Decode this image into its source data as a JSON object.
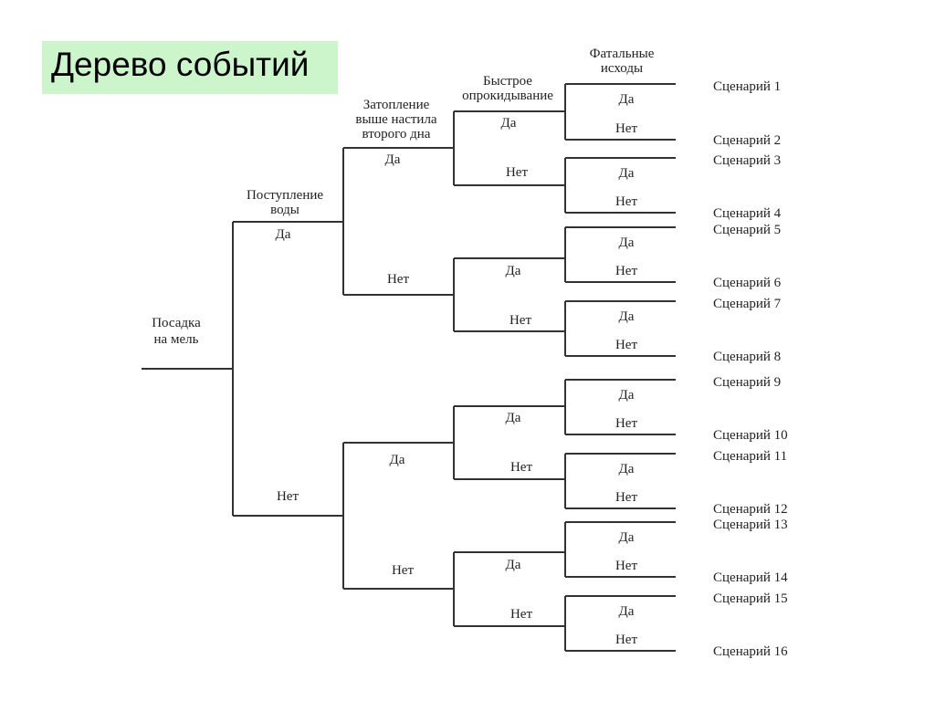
{
  "title": "Дерево событий",
  "headers": {
    "initiating_event": [
      "Посадка",
      "на мель"
    ],
    "water_ingress": [
      "Поступление",
      "воды"
    ],
    "flooding": [
      "Затопление",
      "выше настила",
      "второго дна"
    ],
    "capsizing": [
      "Быстрое",
      "опрокидывание"
    ],
    "fatal_outcomes": [
      "Фатальные",
      "исходы"
    ]
  },
  "branch_labels": {
    "yes": "Да",
    "no": "Нет"
  },
  "scenarios": [
    "Сценарий 1",
    "Сценарий 2",
    "Сценарий 3",
    "Сценарий 4",
    "Сценарий 5",
    "Сценарий 6",
    "Сценарий 7",
    "Сценарий 8",
    "Сценарий 9",
    "Сценарий 10",
    "Сценарий 11",
    "Сценарий 12",
    "Сценарий 13",
    "Сценарий 14",
    "Сценарий 15",
    "Сценарий 16"
  ],
  "colors": {
    "title_bg": "#ccf5cc",
    "line": "#333333"
  }
}
